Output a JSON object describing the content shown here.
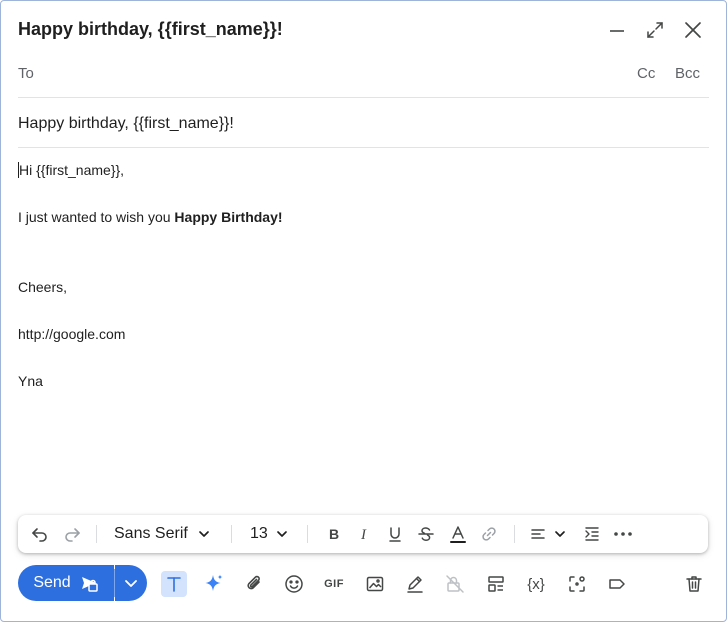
{
  "window": {
    "title": "Happy birthday, {{first_name}}!"
  },
  "recipients": {
    "to_label": "To",
    "cc_label": "Cc",
    "bcc_label": "Bcc"
  },
  "subject": "Happy birthday, {{first_name}}!",
  "body": {
    "greeting": "Hi {{first_name}},",
    "line1_prefix": "I just wanted to wish you ",
    "line1_bold": "Happy Birthday!",
    "sign_off": "Cheers,",
    "link": "http://google.com",
    "signature": "Yna"
  },
  "formatting": {
    "font_family": "Sans Serif",
    "font_size": "13"
  },
  "bottom_toolbar": {
    "send_label": "Send",
    "gif_label": "GIF",
    "variable_label": "{x}"
  },
  "colors": {
    "primary": "#2e6fe0",
    "active_bg": "#d3e3fd",
    "sparkle": "#3b82f6"
  }
}
